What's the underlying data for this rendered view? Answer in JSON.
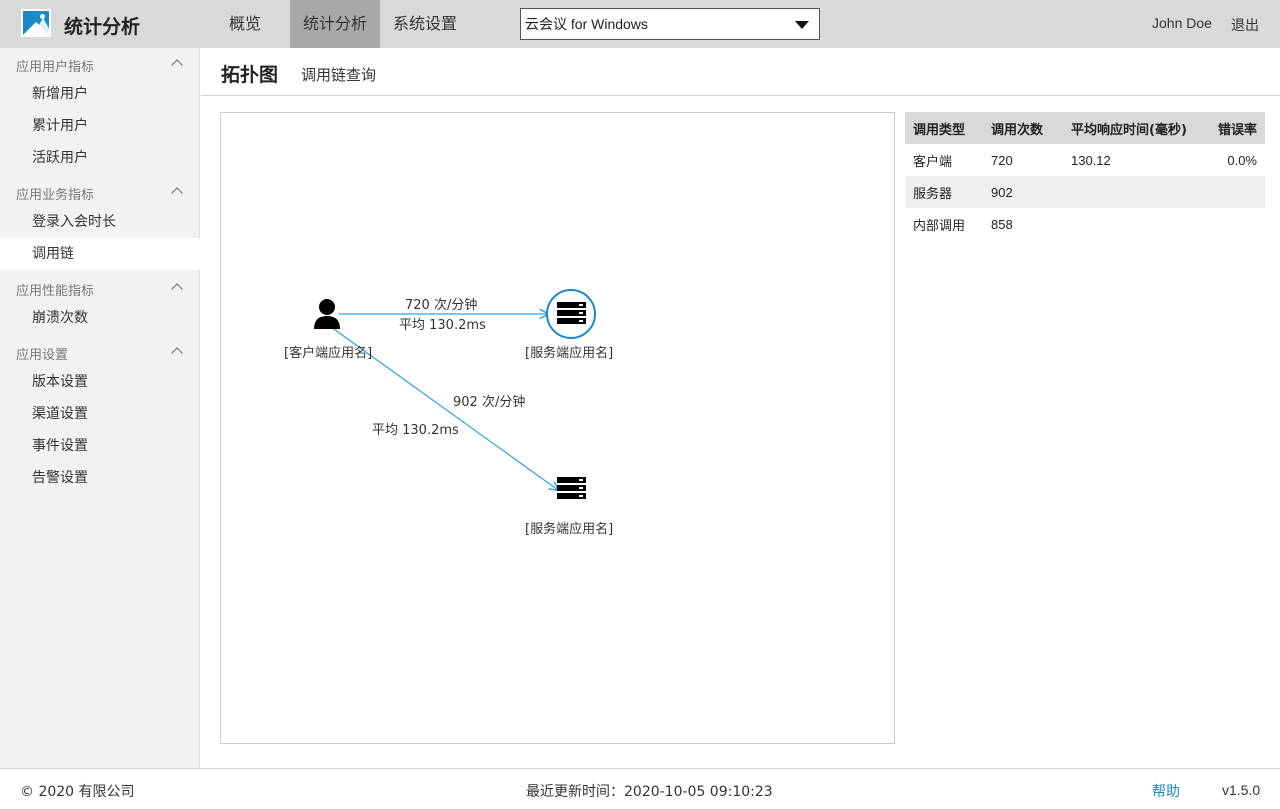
{
  "header": {
    "app_title": "统计分析",
    "tabs": [
      {
        "label": "概览"
      },
      {
        "label": "统计分析"
      },
      {
        "label": "系统设置"
      }
    ],
    "active_tab": "统计分析",
    "app_select": {
      "value": "云会议 for Windows"
    },
    "user_name": "John Doe",
    "logout": "退出"
  },
  "sidebar": {
    "groups": [
      {
        "title": "应用用户指标",
        "items": [
          "新增用户",
          "累计用户",
          "活跃用户"
        ]
      },
      {
        "title": "应用业务指标",
        "items": [
          "登录入会时长",
          "调用链"
        ]
      },
      {
        "title": "应用性能指标",
        "items": [
          "崩溃次数"
        ]
      },
      {
        "title": "应用设置",
        "items": [
          "版本设置",
          "渠道设置",
          "事件设置",
          "告警设置"
        ]
      }
    ],
    "active_item": "调用链"
  },
  "page": {
    "title": "拓扑图",
    "subtitle": "调用链查询"
  },
  "topology": {
    "nodes": [
      {
        "label": "[客户端应用名]",
        "icon": "user-icon"
      },
      {
        "label": "[服务端应用名]",
        "icon": "server-icon",
        "highlighted": true
      },
      {
        "label": "[服务端应用名]",
        "icon": "server-icon"
      }
    ],
    "edges": [
      {
        "rate": "720 次/分钟",
        "avg": "平均 130.2ms"
      },
      {
        "rate": "902 次/分钟",
        "avg": "平均 130.2ms"
      }
    ],
    "edge_color": "#29a3dc"
  },
  "stats_table": {
    "headers": [
      "调用类型",
      "调用次数",
      "平均响应时间(毫秒)",
      "错误率"
    ],
    "rows": [
      [
        "客户端",
        "720",
        "130.12",
        "0.0%"
      ],
      [
        "服务器",
        "902",
        "",
        ""
      ],
      [
        "内部调用",
        "858",
        "",
        ""
      ]
    ]
  },
  "footer": {
    "copyright": "© 2020 有限公司",
    "last_update": "最近更新时间：2020-10-05 09:10:23",
    "help": "帮助",
    "version": "v1.5.0"
  },
  "colors": {
    "accent": "#1a88c9",
    "header_bg": "#d9d9d9",
    "active_tab_bg": "#a8a8a8",
    "sidebar_bg": "#f2f2f2"
  }
}
